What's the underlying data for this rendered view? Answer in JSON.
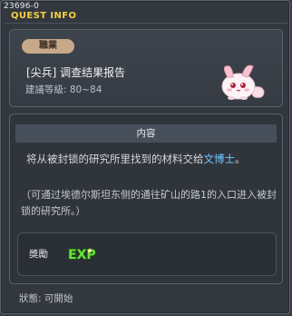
{
  "window": {
    "quest_id": "23696-0",
    "title": "QUEST INFO"
  },
  "header": {
    "category": "職業",
    "quest_name": "[尖兵] 调查结果报告",
    "level_requirement": "建議等級: 80~84",
    "mascot_icon": "pink-bunny-mascot-icon"
  },
  "content": {
    "section_title": "内容",
    "description_before": "将从被封锁的研究所里找到的材料交给",
    "npc_name": "文博士",
    "description_after": "。",
    "note": "（可通过埃德尔斯坦东侧的通往矿山的路1的入口进入被封锁的研究所。）"
  },
  "reward": {
    "label": "獎勵",
    "exp_text": "EXP",
    "exp_icon": "exp-reward-icon"
  },
  "status": {
    "text": "狀態: 可開始"
  },
  "colors": {
    "title": "#f4d03f",
    "npc_link": "#6fc6ff",
    "exp_green": "#66e23a",
    "badge": "#c7a98a"
  }
}
